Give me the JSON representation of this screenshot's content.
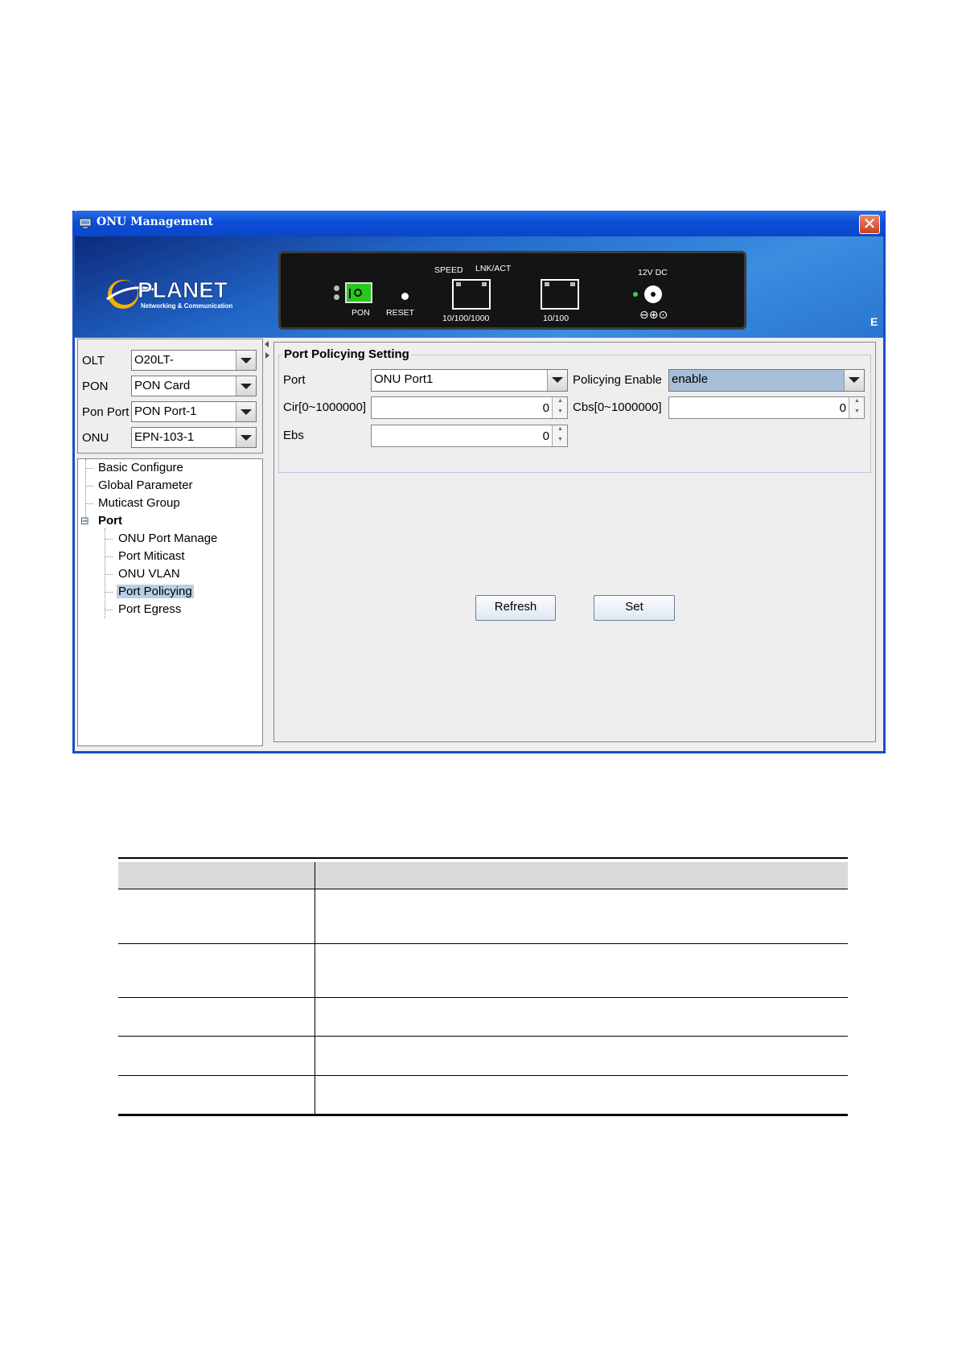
{
  "window": {
    "title": "ONU Management",
    "close_label": "✕",
    "banner_edge_text": "E"
  },
  "brand": {
    "name": "PLANET",
    "tagline": "Networking & Communication"
  },
  "device": {
    "pon_label": "PON",
    "reset_label": "RESET",
    "speed_label": "SPEED",
    "lnk_label": "LNK/ACT",
    "port1_label": "10/100/1000",
    "port2_label": "10/100",
    "power_label": "12V DC"
  },
  "selectors": [
    {
      "label": "OLT",
      "value": "O20LT-"
    },
    {
      "label": "PON",
      "value": "PON Card"
    },
    {
      "label": "Pon Port",
      "value": "PON Port-1"
    },
    {
      "label": "ONU",
      "value": "EPN-103-1"
    }
  ],
  "tree": {
    "items": [
      "Basic Configure",
      "Global Parameter",
      "Muticast Group"
    ],
    "folder": {
      "label": "Port",
      "toggle": "⊟"
    },
    "children": [
      "ONU Port Manage",
      "Port Miticast",
      "ONU VLAN",
      "Port Policying",
      "Port Egress"
    ],
    "selected": "Port Policying"
  },
  "form": {
    "group_title": "Port Policying Setting",
    "port_label": "Port",
    "port_value": "ONU Port1",
    "policying_enable_label": "Policying Enable",
    "policying_enable_value": "enable",
    "cir_label": "Cir[0~1000000]",
    "cir_value": "0",
    "cbs_label": "Cbs[0~1000000]",
    "cbs_value": "0",
    "ebs_label": "Ebs",
    "ebs_value": "0"
  },
  "buttons": {
    "refresh": "Refresh",
    "set": "Set"
  },
  "colors": {
    "titlebar": "#0c4dd8",
    "selected_row": "#b8cfe5",
    "combo_highlight": "#a8bed8",
    "table_header": "#d9d9d9"
  }
}
